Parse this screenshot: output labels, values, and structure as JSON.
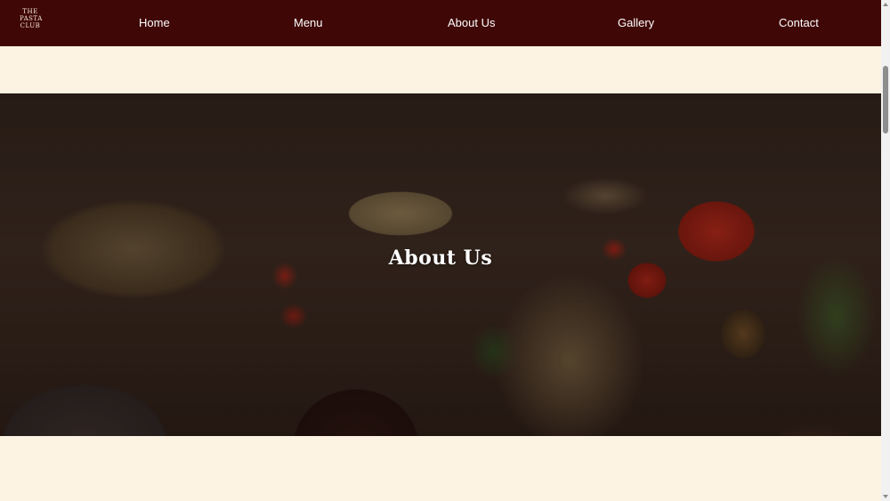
{
  "nav": {
    "logo_lines": [
      "THE",
      "PASTA",
      "CLUB"
    ],
    "links": [
      {
        "label": "Home"
      },
      {
        "label": "Menu"
      },
      {
        "label": "About Us"
      },
      {
        "label": "Gallery"
      },
      {
        "label": "Contact"
      }
    ]
  },
  "hero": {
    "title": "About Us"
  },
  "colors": {
    "nav_bg": "#3f0706",
    "page_bg": "#fdf3e3",
    "nav_text": "#ffffff"
  }
}
